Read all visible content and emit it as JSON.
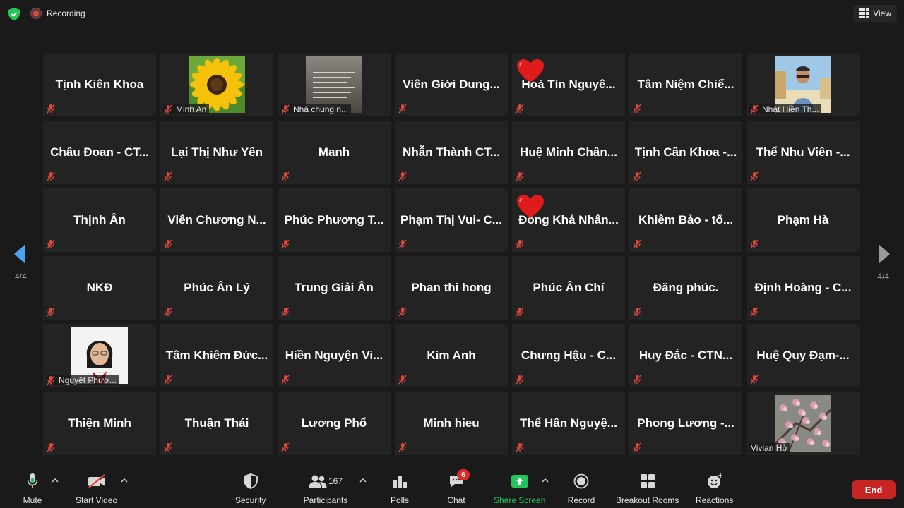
{
  "topbar": {
    "recording_label": "Recording",
    "view_label": "View"
  },
  "page_indicator": "4/4",
  "participants_tiles": [
    {
      "name": "Tịnh Kiên Khoa"
    },
    {
      "name": "",
      "caption": "Minh An",
      "image": "sunflower"
    },
    {
      "name": "",
      "caption": "Nhà chung n...",
      "image": "quote-card"
    },
    {
      "name": "Viên Giới Dung..."
    },
    {
      "name": "Hoà Tín Nguyê...",
      "reaction": "heart"
    },
    {
      "name": "Tâm Niệm Chiế..."
    },
    {
      "name": "",
      "caption": "Nhật Hiền Th...",
      "image": "person-photo"
    },
    {
      "name": "Châu Đoan - CT..."
    },
    {
      "name": "Lại Thị Như Yến"
    },
    {
      "name": "Manh"
    },
    {
      "name": "Nhẫn Thành CT..."
    },
    {
      "name": "Huệ Minh Chân..."
    },
    {
      "name": "Tịnh Cần Khoa -..."
    },
    {
      "name": "Thể Nhu Viên -..."
    },
    {
      "name": "Thịnh Ân"
    },
    {
      "name": "Viên Chương N..."
    },
    {
      "name": "Phúc Phương T..."
    },
    {
      "name": "Phạm Thị Vui- C..."
    },
    {
      "name": "Đồng Khả Nhân...",
      "reaction": "heart"
    },
    {
      "name": "Khiêm Bảo -  tổ..."
    },
    {
      "name": "Phạm Hà"
    },
    {
      "name": "NKĐ"
    },
    {
      "name": "Phúc Ân Lý"
    },
    {
      "name": "Trung Giải Ân"
    },
    {
      "name": "Phan thi hong"
    },
    {
      "name": "Phúc Ân Chí"
    },
    {
      "name": "Đăng phúc."
    },
    {
      "name": "Định Hoàng - C..."
    },
    {
      "name": "",
      "caption": "Nguyệt Phươ...",
      "image": "portrait"
    },
    {
      "name": "Tâm Khiêm Đức..."
    },
    {
      "name": "Hiền Nguyện Vi..."
    },
    {
      "name": "Kim Anh"
    },
    {
      "name": "Chưng Hậu - C..."
    },
    {
      "name": "Huy Đắc - CTN..."
    },
    {
      "name": "Huệ Quy Đạm-..."
    },
    {
      "name": "Thiện Minh"
    },
    {
      "name": "Thuận Thái"
    },
    {
      "name": "Lương Phổ"
    },
    {
      "name": "Minh hieu"
    },
    {
      "name": "Thể Hân Nguyệ..."
    },
    {
      "name": "Phong Lương -..."
    },
    {
      "name": "",
      "caption": "Vivian Hò",
      "image": "blossom",
      "unmuted": true
    }
  ],
  "toolbar": {
    "mute": "Mute",
    "start_video": "Start Video",
    "security": "Security",
    "participants": "Participants",
    "participants_count": "167",
    "polls": "Polls",
    "chat": "Chat",
    "chat_badge": "6",
    "share_screen": "Share Screen",
    "record": "Record",
    "breakout_rooms": "Breakout Rooms",
    "reactions": "Reactions",
    "end": "End"
  },
  "colors": {
    "background": "#1a1a1a",
    "tile": "#232323",
    "muted_red": "#e0483a",
    "share_green": "#23c55a",
    "end_red": "#c72424",
    "arrow_blue": "#4aa3f0"
  }
}
